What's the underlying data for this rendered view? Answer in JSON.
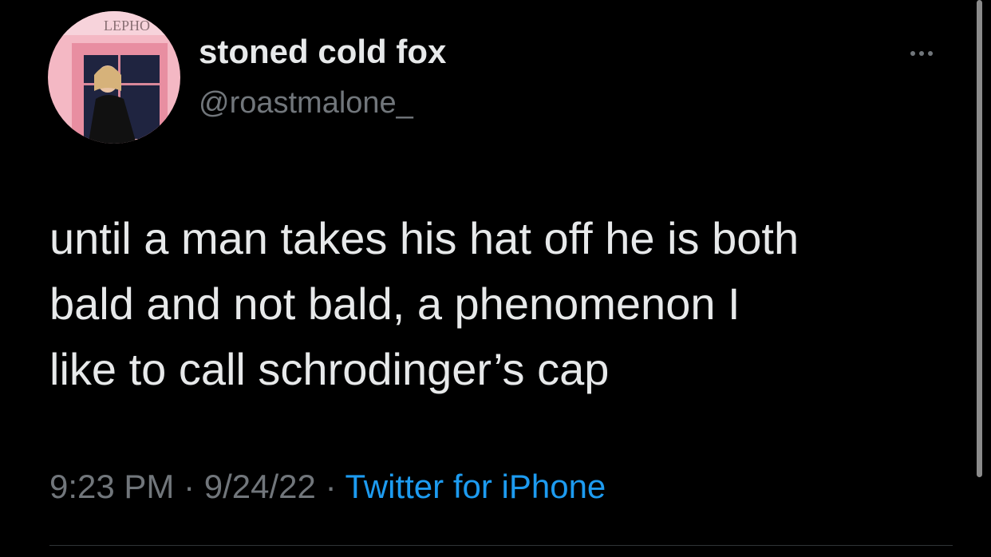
{
  "tweet": {
    "author": {
      "display_name": "stoned cold fox",
      "handle": "@roastmalone_",
      "avatar_sign_text": "LEPHO"
    },
    "text_lines": [
      "until a man takes his hat off he is both",
      "bald and not bald, a phenomenon I",
      "like to call schrodinger’s cap"
    ],
    "time": "9:23 PM",
    "date": "9/24/22",
    "source": "Twitter for iPhone",
    "separator": "·"
  },
  "icons": {
    "more": "more-horizontal-icon"
  },
  "colors": {
    "background": "#000000",
    "text": "#e7e9ea",
    "secondary": "#71767b",
    "link": "#1d9bf0"
  }
}
